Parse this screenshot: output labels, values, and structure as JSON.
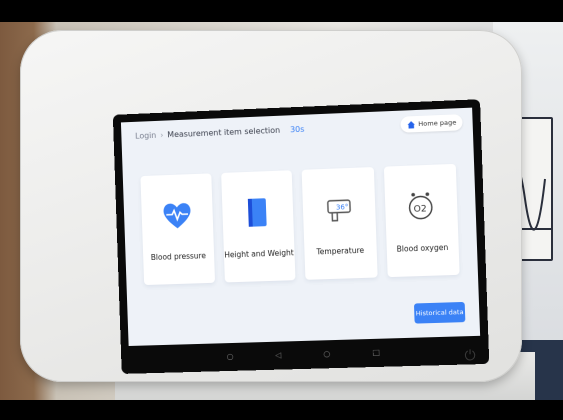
{
  "header": {
    "breadcrumb_login": "Login",
    "breadcrumb_separator": "›",
    "breadcrumb_current": "Measurement item selection",
    "countdown": "30s",
    "home_label": "Home page"
  },
  "measurements": [
    {
      "label": "Blood pressure",
      "icon": "heart-pulse-icon"
    },
    {
      "label": "Height and Weight",
      "icon": "scale-icon"
    },
    {
      "label": "Temperature",
      "icon": "thermometer-gun-icon"
    },
    {
      "label": "Blood oxygen",
      "icon": "o2-icon"
    }
  ],
  "temperature_icon_text": "36°",
  "o2_icon_text": "O2",
  "historical_button": "Historical data",
  "colors": {
    "accent": "#3b82f6",
    "background": "#eef2f8"
  }
}
